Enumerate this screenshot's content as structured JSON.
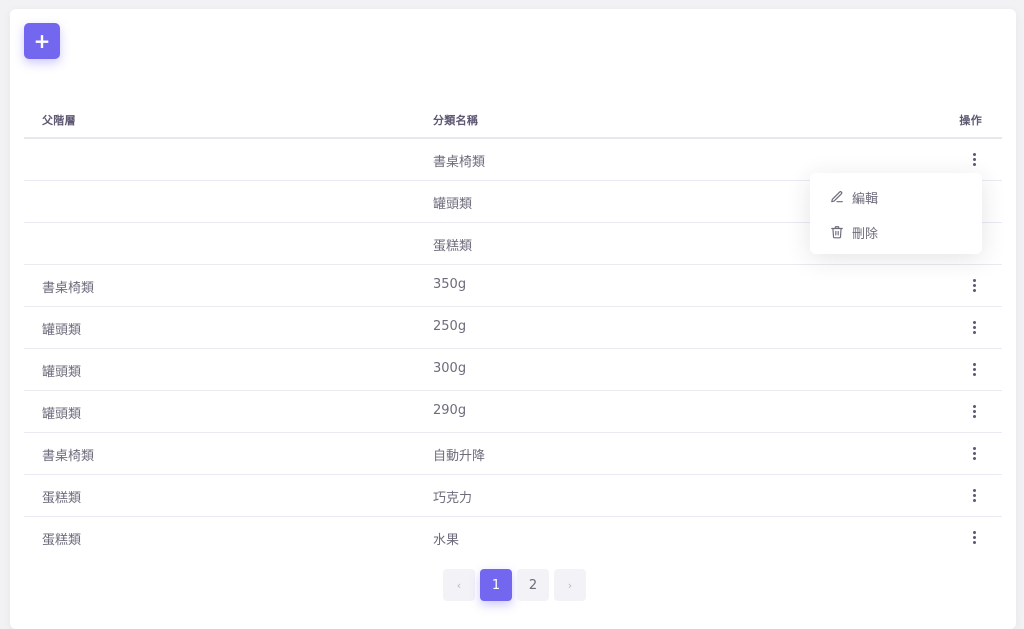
{
  "toolbar": {
    "add_label": "+"
  },
  "table": {
    "headers": [
      "父階層",
      "分類名稱",
      "操作"
    ],
    "rows": [
      {
        "parent": "",
        "name": "書桌椅類"
      },
      {
        "parent": "",
        "name": "罐頭類"
      },
      {
        "parent": "",
        "name": "蛋糕類"
      },
      {
        "parent": "書桌椅類",
        "name": "350g"
      },
      {
        "parent": "罐頭類",
        "name": "250g"
      },
      {
        "parent": "罐頭類",
        "name": "300g"
      },
      {
        "parent": "罐頭類",
        "name": "290g"
      },
      {
        "parent": "書桌椅類",
        "name": "自動升降"
      },
      {
        "parent": "蛋糕類",
        "name": "巧克力"
      },
      {
        "parent": "蛋糕類",
        "name": "水果"
      }
    ]
  },
  "menu": {
    "edit_label": "編輯",
    "delete_label": "刪除"
  },
  "pagination": {
    "prev": "‹",
    "next": "›",
    "pages": [
      "1",
      "2"
    ],
    "current": "1"
  },
  "colors": {
    "accent": "#7367f0"
  },
  "icons": {
    "edit": "pencil-icon",
    "delete": "trash-icon",
    "row_action": "more-vertical-icon"
  }
}
